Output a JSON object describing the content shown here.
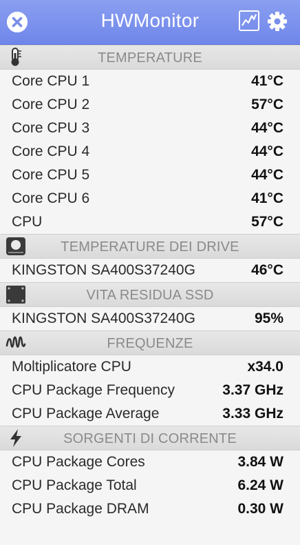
{
  "window": {
    "title": "HWMonitor"
  },
  "icons": {
    "close": "close-icon",
    "chart": "chart-icon",
    "settings": "gear-icon"
  },
  "sections": [
    {
      "key": "temperature",
      "icon": "thermometer-icon",
      "title": "TEMPERATURE",
      "rows": [
        {
          "name": "Core CPU 1",
          "value": "41°C"
        },
        {
          "name": "Core CPU 2",
          "value": "57°C"
        },
        {
          "name": "Core CPU 3",
          "value": "44°C"
        },
        {
          "name": "Core CPU 4",
          "value": "44°C"
        },
        {
          "name": "Core CPU 5",
          "value": "44°C"
        },
        {
          "name": "Core CPU 6",
          "value": "41°C"
        },
        {
          "name": "CPU",
          "value": "57°C"
        }
      ]
    },
    {
      "key": "drive-temperature",
      "icon": "hard-drive-icon",
      "title": "TEMPERATURE DEI DRIVE",
      "rows": [
        {
          "name": "KINGSTON SA400S37240G",
          "value": "46°C"
        }
      ]
    },
    {
      "key": "ssd-life",
      "icon": "ssd-icon",
      "title": "VITA RESIDUA SSD",
      "rows": [
        {
          "name": "KINGSTON SA400S37240G",
          "value": "95%"
        }
      ]
    },
    {
      "key": "frequencies",
      "icon": "frequency-wave-icon",
      "title": "FREQUENZE",
      "rows": [
        {
          "name": "Moltiplicatore CPU",
          "value": "x34.0"
        },
        {
          "name": "CPU Package Frequency",
          "value": "3.37 GHz"
        },
        {
          "name": "CPU Package Average",
          "value": "3.33 GHz"
        }
      ]
    },
    {
      "key": "power-sources",
      "icon": "lightning-icon",
      "title": "SORGENTI DI CORRENTE",
      "rows": [
        {
          "name": "CPU Package Cores",
          "value": "3.84 W"
        },
        {
          "name": "CPU Package Total",
          "value": "6.24 W"
        },
        {
          "name": "CPU Package DRAM",
          "value": "0.30 W"
        }
      ]
    }
  ]
}
